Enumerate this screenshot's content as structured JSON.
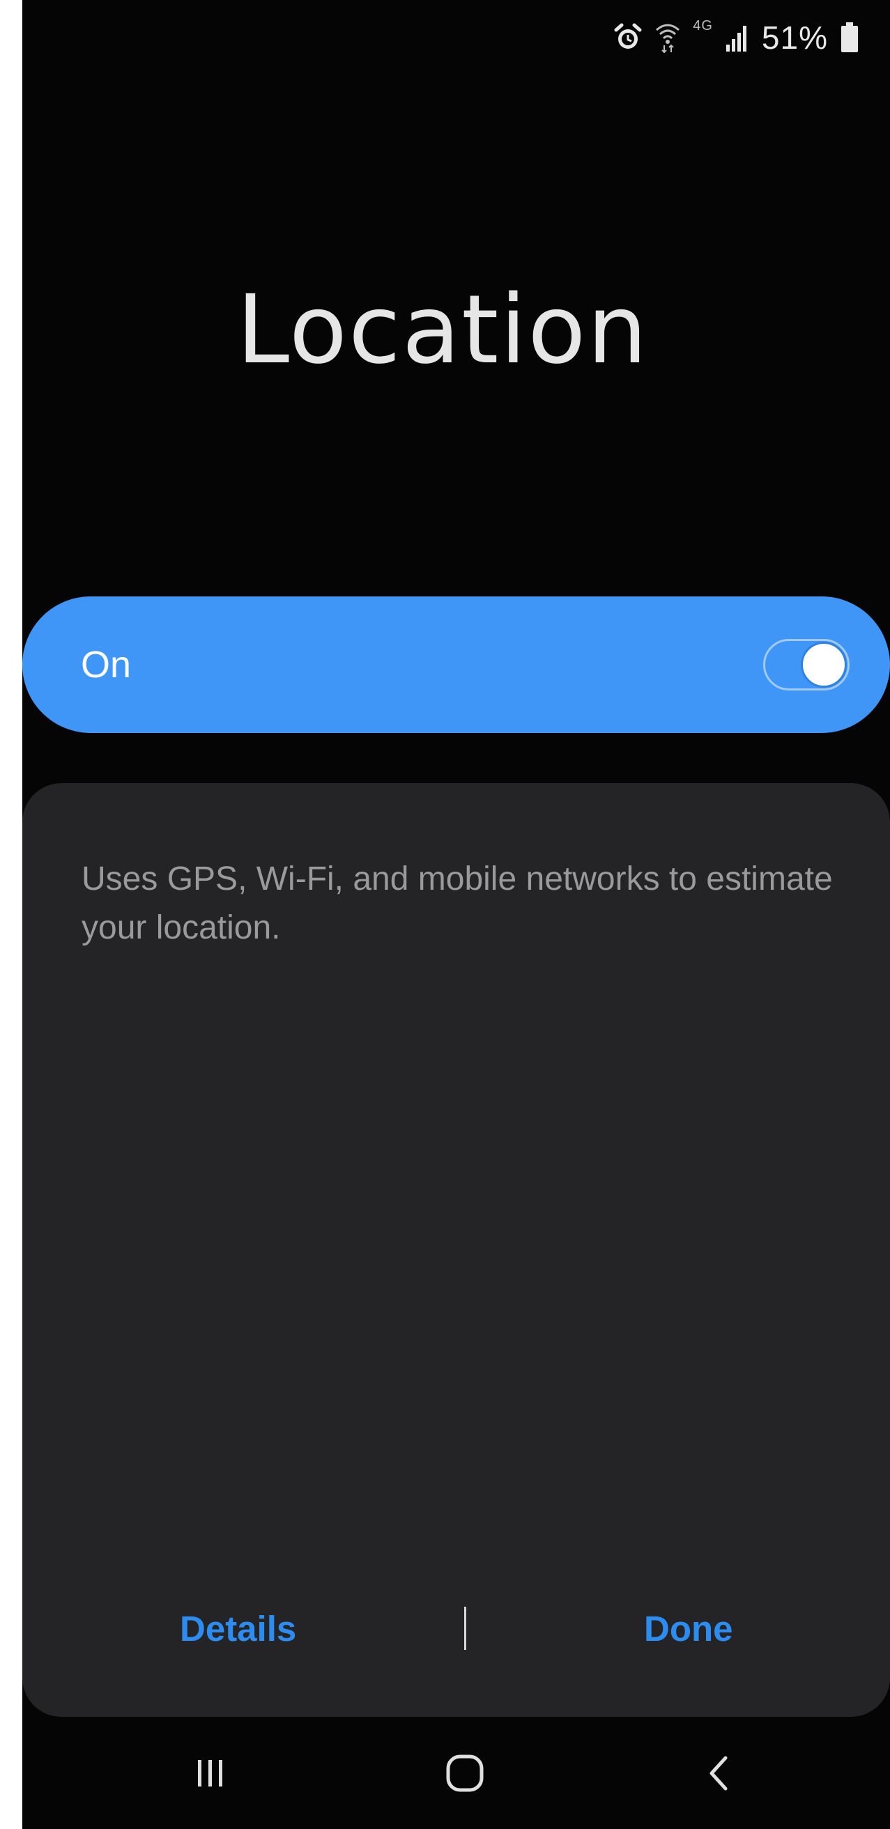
{
  "status_bar": {
    "icons": [
      "alarm-icon",
      "wifi-icon",
      "lte-icon",
      "signal-icon",
      "battery-icon"
    ],
    "lte_label": "4G",
    "battery_percent": "51%"
  },
  "page": {
    "title": "Location"
  },
  "toggle": {
    "label": "On",
    "state": true
  },
  "info_card": {
    "description": "Uses GPS, Wi-Fi, and mobile networks to estimate your location.",
    "details_label": "Details",
    "done_label": "Done"
  },
  "nav_bar": {
    "icons": [
      "recents-icon",
      "home-icon",
      "back-icon"
    ]
  },
  "colors": {
    "background": "#050506",
    "accent": "#3f96f7",
    "card": "#242426",
    "action_text": "#2d8cf0"
  }
}
